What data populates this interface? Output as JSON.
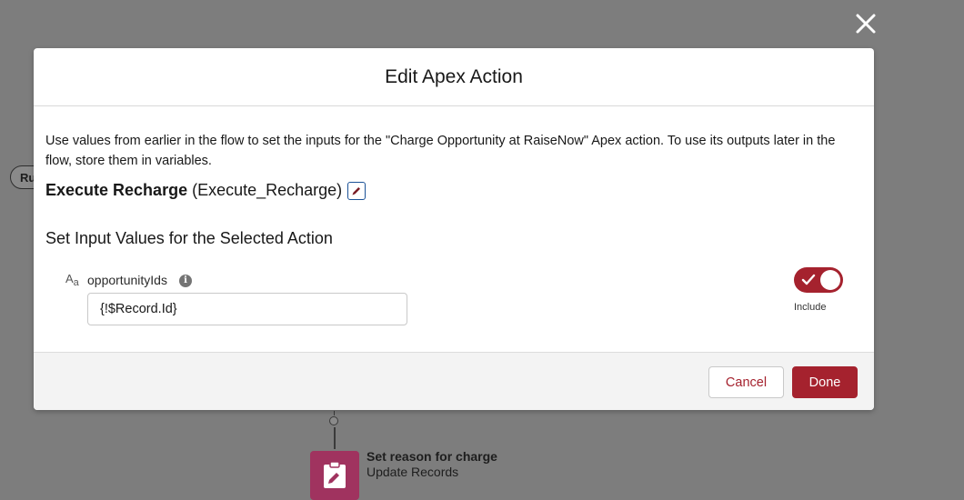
{
  "background": {
    "pill_label": "Ru",
    "node_title": "Set reason for charge",
    "node_subtitle": "Update Records"
  },
  "modal": {
    "title": "Edit Apex Action",
    "intro": "Use values from earlier in the flow to set the inputs for the \"Charge Opportunity at RaiseNow\" Apex action. To use its outputs later in the flow, store them in variables.",
    "action_label": "Execute Recharge",
    "action_api_name": "(Execute_Recharge)",
    "section_title": "Set Input Values for the Selected Action",
    "parameter": {
      "type_glyph_upper": "A",
      "type_glyph_lower": "a",
      "label": "opportunityIds",
      "info_glyph": "i",
      "value": "{!$Record.Id}",
      "include_label": "Include",
      "include_enabled": true
    },
    "footer": {
      "cancel_label": "Cancel",
      "done_label": "Done"
    }
  },
  "colors": {
    "brand": "#a5222e",
    "node_icon": "#a0335f",
    "overlay": "#7d7d7d"
  }
}
